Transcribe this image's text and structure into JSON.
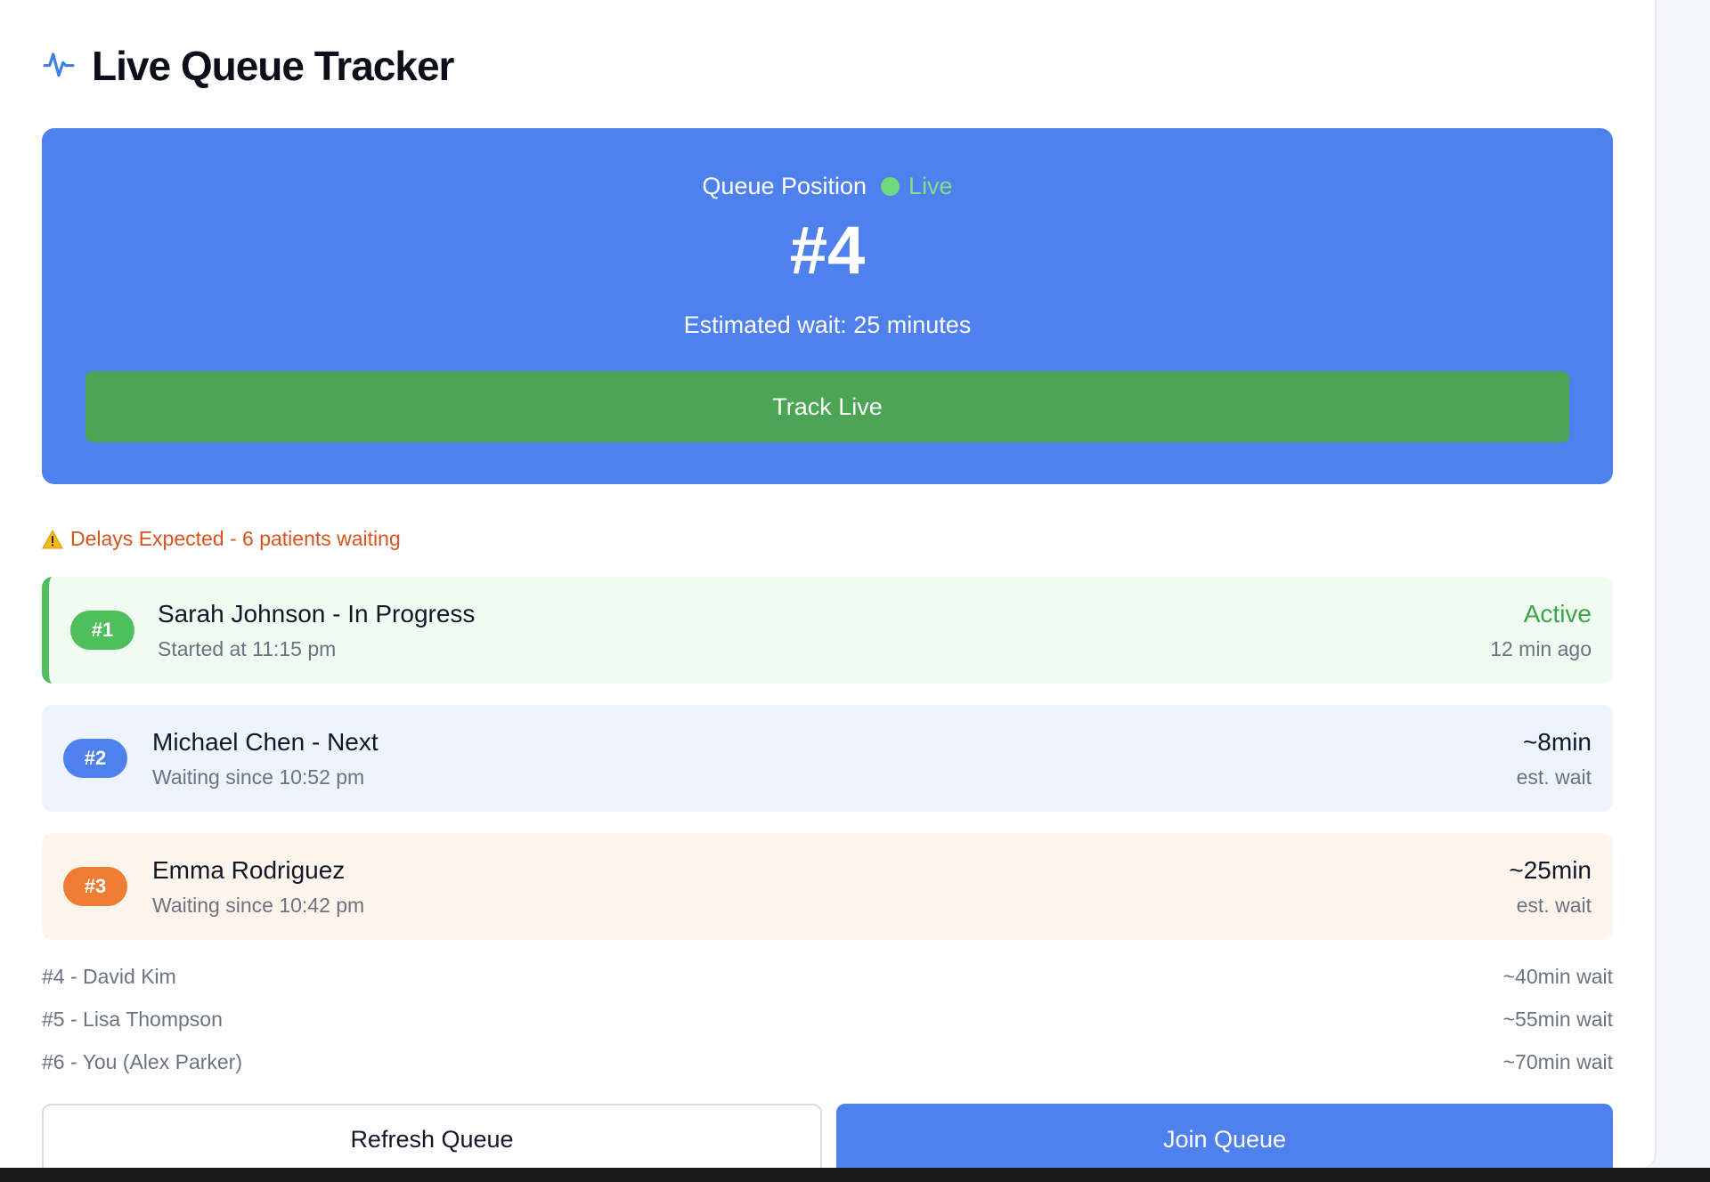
{
  "header": {
    "title": "Live Queue Tracker",
    "icon": "activity-pulse-icon"
  },
  "hero": {
    "label": "Queue Position",
    "live_label": "Live",
    "position": "#4",
    "estimated_wait": "Estimated wait: 25 minutes",
    "track_button": "Track Live"
  },
  "alert": {
    "text": "Delays Expected - 6 patients waiting",
    "icon": "warning-icon"
  },
  "queue": [
    {
      "badge": "#1",
      "name": "Sarah Johnson - In Progress",
      "sub": "Started at 11:15 pm",
      "right_main": "Active",
      "right_sub": "12 min ago"
    },
    {
      "badge": "#2",
      "name": "Michael Chen - Next",
      "sub": "Waiting since 10:52 pm",
      "right_main": "~8min",
      "right_sub": "est. wait"
    },
    {
      "badge": "#3",
      "name": "Emma Rodriguez",
      "sub": "Waiting since 10:42 pm",
      "right_main": "~25min",
      "right_sub": "est. wait"
    }
  ],
  "simple_queue": [
    {
      "label": "#4 - David Kim",
      "wait": "~40min wait"
    },
    {
      "label": "#5 - Lisa Thompson",
      "wait": "~55min wait"
    },
    {
      "label": "#6 - You (Alex Parker)",
      "wait": "~70min wait"
    }
  ],
  "buttons": {
    "refresh": "Refresh Queue",
    "join": "Join Queue"
  },
  "colors": {
    "primary": "#4f81ee",
    "success": "#4ca455",
    "warning": "#d9531e"
  }
}
